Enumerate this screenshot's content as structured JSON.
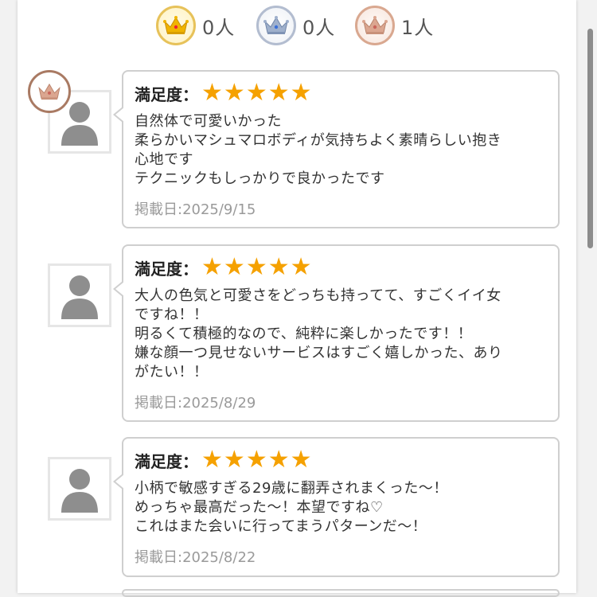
{
  "ranking": {
    "gold": {
      "count": "0人",
      "icon": "gold-crown-icon",
      "color": "#e9b100"
    },
    "silver": {
      "count": "0人",
      "icon": "silver-crown-icon",
      "color": "#6f85a8"
    },
    "bronze": {
      "count": "1人",
      "icon": "bronze-crown-icon",
      "color": "#b9836b"
    }
  },
  "reviews": [
    {
      "satisfaction_label": "満足度：",
      "stars": 5,
      "comment": "自然体で可愛いかった\n柔らかいマシュマロボディが気持ちよく素晴らしい抱き\n心地です\nテクニックもしっかりで良かったです",
      "date": "掲載日:2025/9/15",
      "badge": "bronze-crown-icon"
    },
    {
      "satisfaction_label": "満足度：",
      "stars": 5,
      "comment": "大人の色気と可愛さをどっちも持ってて、すごくイイ女\nですね！！\n明るくて積極的なので、純粋に楽しかったです！！\n嫌な顔一つ見せないサービスはすごく嬉しかった、あり\nがたい！！",
      "date": "掲載日:2025/8/29"
    },
    {
      "satisfaction_label": "満足度：",
      "stars": 5,
      "comment": "小柄で敏感すぎる29歳に翻弄されまくった～！\nめっちゃ最高だった～！本望ですね♡\nこれはまた会いに行ってまうパターンだ～！",
      "date": "掲載日:2025/8/22"
    }
  ],
  "colors": {
    "star": "#f5a100",
    "card_border": "#cfcfcf",
    "date_text": "#9a9a9a"
  }
}
